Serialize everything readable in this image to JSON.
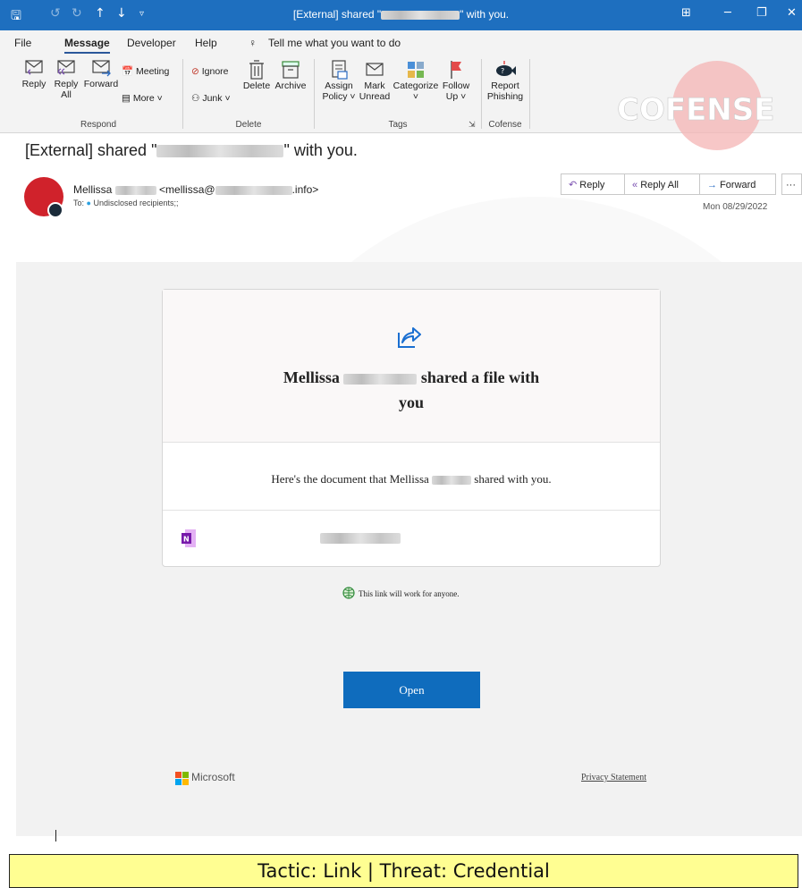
{
  "titlebar": {
    "title_prefix": "[External] shared \"",
    "title_suffix": "\" with you.",
    "quick_access": [
      "save-icon",
      "undo-icon",
      "redo-icon",
      "up-icon",
      "down-icon",
      "customize-icon"
    ]
  },
  "menu": {
    "tabs": [
      "File",
      "Message",
      "Developer",
      "Help"
    ],
    "active": "Message",
    "tell_me": "Tell me what you want to do"
  },
  "ribbon": {
    "respond": {
      "reply": "Reply",
      "reply_all": "Reply All",
      "forward": "Forward",
      "meeting": "Meeting",
      "more": "More ˅",
      "group": "Respond"
    },
    "delete": {
      "ignore": "Ignore",
      "junk": "Junk ˅",
      "delete": "Delete",
      "archive": "Archive",
      "group": "Delete"
    },
    "tags": {
      "assign_policy": "Assign Policy ˅",
      "mark_unread": "Mark Unread",
      "categorize": "Categorize ˅",
      "follow_up": "Follow Up ˅",
      "group": "Tags"
    },
    "cofense": {
      "report_phishing": "Report Phishing",
      "group": "Cofense"
    }
  },
  "logo_text": "COFENSE",
  "email": {
    "subject_prefix": "[External] shared \"",
    "subject_suffix": "\" with you.",
    "sender_first": "Mellissa",
    "sender_email_prefix": "<mellissa@",
    "sender_email_suffix": ".info>",
    "to_label": "To:",
    "to_value": "Undisclosed recipients;;",
    "date": "Mon 08/29/2022",
    "actions": {
      "reply": "Reply",
      "reply_all": "Reply All",
      "forward": "Forward",
      "more": "···"
    }
  },
  "card": {
    "heading_name": "Mellissa",
    "heading_rest": "shared a file with",
    "heading_line2": "you",
    "message_prefix": "Here's the document that Mellissa",
    "message_suffix": "shared with you.",
    "link_note": "This link will work for anyone.",
    "open_button": "Open",
    "ms_brand": "Microsoft",
    "privacy": "Privacy Statement"
  },
  "banner": {
    "text": "Tactic: Link | Threat: Credential"
  },
  "colors": {
    "titlebar": "#1e6fbf",
    "avatar": "#d0222b",
    "open_button": "#0f6cbd",
    "banner": "#fffe92",
    "logo_circle": "#f4b4b4"
  }
}
